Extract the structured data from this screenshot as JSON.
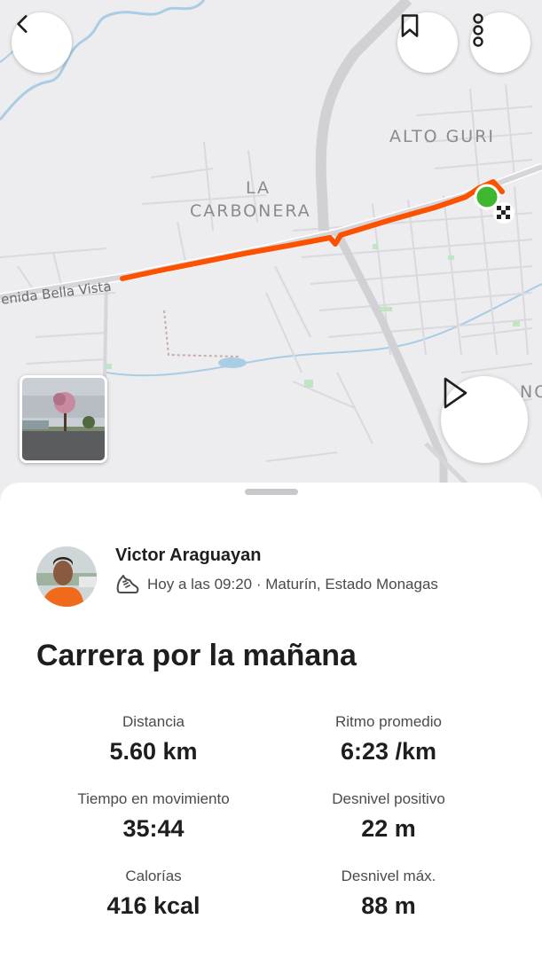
{
  "map": {
    "labels": {
      "alto_guri": "ALTO GURI",
      "la": "LA",
      "carbonera": "CARBONERA",
      "street": "enida Bella Vista",
      "cut_off": "NO"
    },
    "icons": {
      "back": "chevron-left-icon",
      "bookmark": "bookmark-icon",
      "more": "more-vertical-icon",
      "play": "play-icon"
    },
    "colors": {
      "route": "#fc5200",
      "start": "#3fb72e",
      "road": "#d6d6da",
      "water": "#a9cde4",
      "park": "#bfe5c4"
    }
  },
  "athlete": {
    "name": "Victor Araguayan",
    "meta": "Hoy a las 09:20 · Maturín, Estado Monagas",
    "sport_icon": "running-shoe-icon"
  },
  "activity": {
    "title": "Carrera por la mañana"
  },
  "stats": [
    {
      "label": "Distancia",
      "value": "5.60 km"
    },
    {
      "label": "Ritmo promedio",
      "value": "6:23 /km"
    },
    {
      "label": "Tiempo en movimiento",
      "value": "35:44"
    },
    {
      "label": "Desnivel positivo",
      "value": "22 m"
    },
    {
      "label": "Calorías",
      "value": "416 kcal"
    },
    {
      "label": "Desnivel máx.",
      "value": "88 m"
    }
  ]
}
